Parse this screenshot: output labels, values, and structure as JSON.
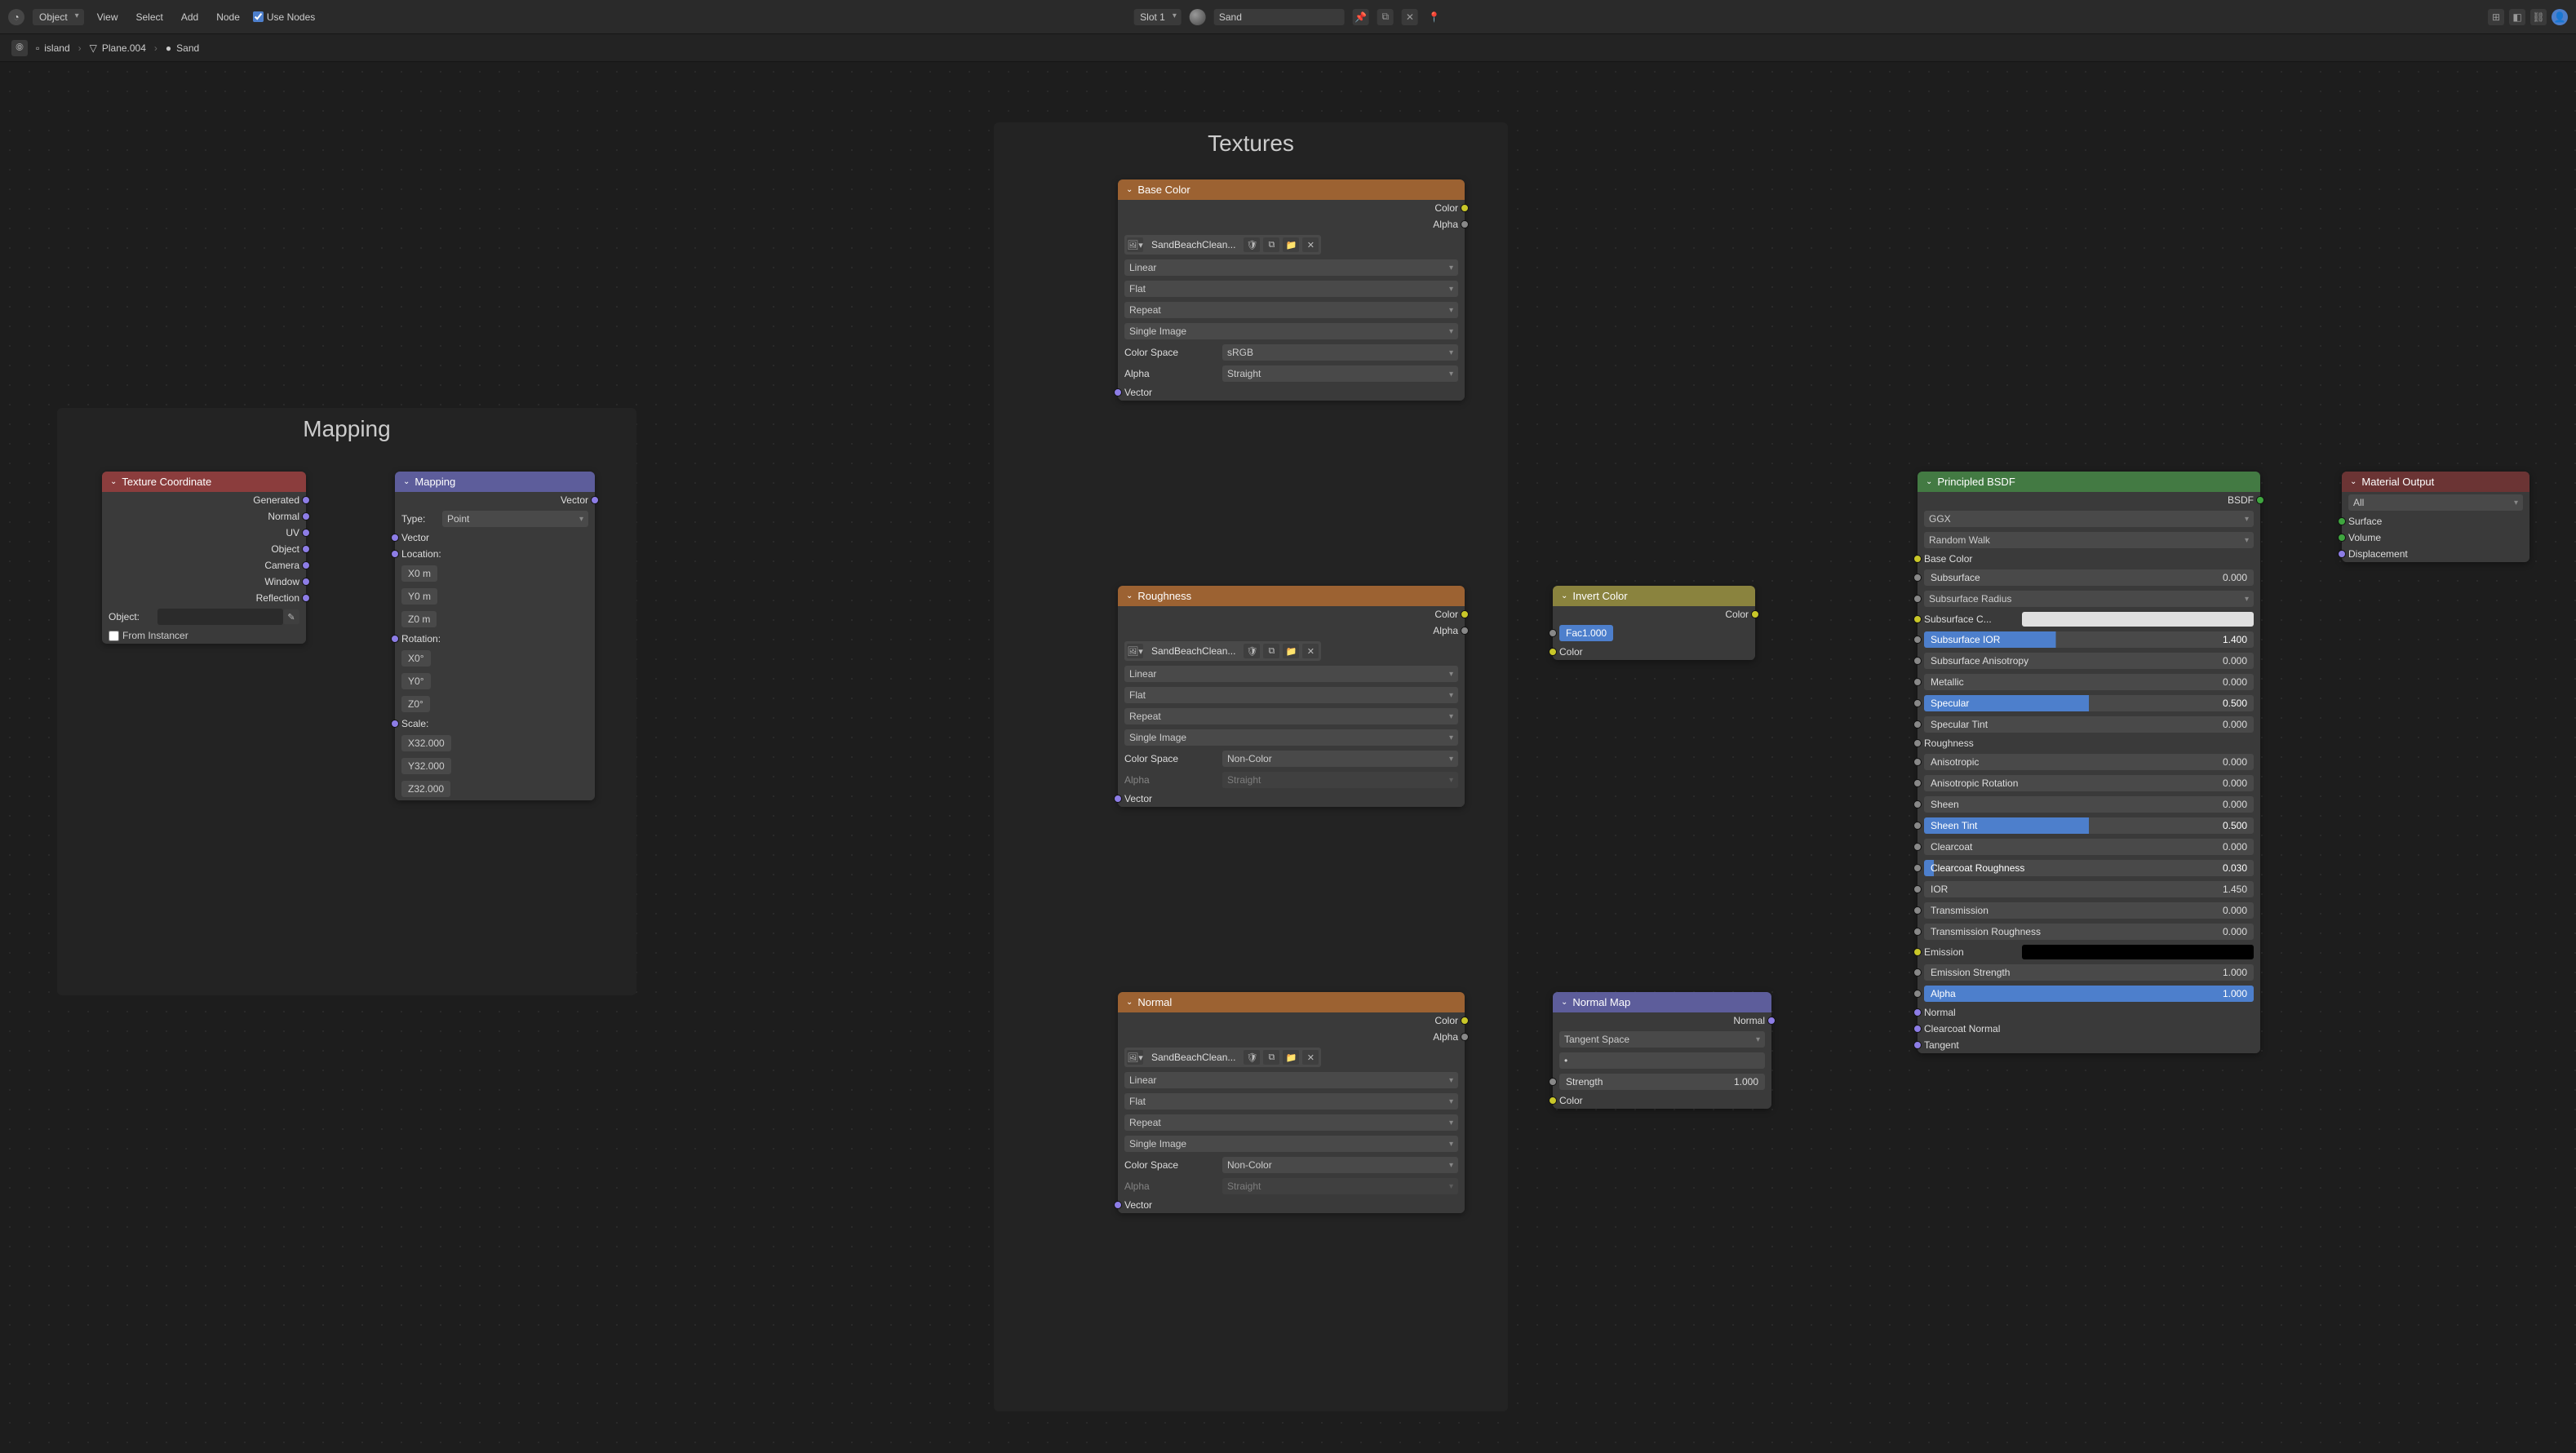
{
  "topbar": {
    "mode": "Object",
    "menus": [
      "View",
      "Select",
      "Add",
      "Node"
    ],
    "use_nodes": "Use Nodes",
    "slot": "Slot 1",
    "material": "Sand"
  },
  "breadcrumb": {
    "items": [
      "island",
      "Plane.004",
      "Sand"
    ]
  },
  "frames": {
    "mapping": "Mapping",
    "textures": "Textures"
  },
  "texcoord": {
    "title": "Texture Coordinate",
    "outs": [
      "Generated",
      "Normal",
      "UV",
      "Object",
      "Camera",
      "Window",
      "Reflection"
    ],
    "object_lbl": "Object:",
    "from_instancer": "From Instancer"
  },
  "mapping": {
    "title": "Mapping",
    "out": "Vector",
    "vector": "Vector",
    "type_lbl": "Type:",
    "type_val": "Point",
    "location": "Location:",
    "loc": {
      "x": "X",
      "xv": "0 m",
      "y": "Y",
      "yv": "0 m",
      "z": "Z",
      "zv": "0 m"
    },
    "rotation": "Rotation:",
    "rot": {
      "x": "X",
      "xv": "0°",
      "y": "Y",
      "yv": "0°",
      "z": "Z",
      "zv": "0°"
    },
    "scale": "Scale:",
    "scl": {
      "x": "X",
      "xv": "32.000",
      "y": "Y",
      "yv": "32.000",
      "z": "Z",
      "zv": "32.000"
    }
  },
  "img": {
    "color": "Color",
    "alpha": "Alpha",
    "vector": "Vector",
    "name": "SandBeachClean...",
    "interp": "Linear",
    "proj": "Flat",
    "ext": "Repeat",
    "source": "Single Image",
    "colorspace_lbl": "Color Space",
    "srgb": "sRGB",
    "noncolor": "Non-Color",
    "alpha_lbl": "Alpha",
    "straight": "Straight"
  },
  "tex_nodes": {
    "base": "Base Color",
    "rough": "Roughness",
    "normal": "Normal"
  },
  "invert": {
    "title": "Invert Color",
    "out": "Color",
    "fac": "Fac",
    "fac_v": "1.000",
    "color": "Color"
  },
  "nmap": {
    "title": "Normal Map",
    "out": "Normal",
    "space": "Tangent Space",
    "uvmap": "•",
    "strength": "Strength",
    "strength_v": "1.000",
    "color": "Color"
  },
  "bsdf": {
    "title": "Principled BSDF",
    "out": "BSDF",
    "distribution": "GGX",
    "sss": "Random Walk",
    "rows": [
      {
        "k": "base",
        "lbl": "Base Color",
        "sock": "yellow",
        "type": "text",
        "connected": true
      },
      {
        "k": "subsurface",
        "lbl": "Subsurface",
        "val": "0.000",
        "type": "prop"
      },
      {
        "k": "sss_radius",
        "lbl": "Subsurface Radius",
        "type": "drop"
      },
      {
        "k": "sss_color",
        "lbl": "Subsurface C...",
        "type": "color",
        "color": "#e0e0e0",
        "sock": "yellow"
      },
      {
        "k": "sss_ior",
        "lbl": "Subsurface IOR",
        "val": "1.400",
        "type": "lit",
        "pct": 40
      },
      {
        "k": "sss_aniso",
        "lbl": "Subsurface Anisotropy",
        "val": "0.000",
        "type": "prop"
      },
      {
        "k": "metallic",
        "lbl": "Metallic",
        "val": "0.000",
        "type": "prop"
      },
      {
        "k": "specular",
        "lbl": "Specular",
        "val": "0.500",
        "type": "lit",
        "pct": 50
      },
      {
        "k": "spectint",
        "lbl": "Specular Tint",
        "val": "0.000",
        "type": "prop"
      },
      {
        "k": "rough",
        "lbl": "Roughness",
        "type": "text",
        "connected": true
      },
      {
        "k": "aniso",
        "lbl": "Anisotropic",
        "val": "0.000",
        "type": "prop"
      },
      {
        "k": "aniso_rot",
        "lbl": "Anisotropic Rotation",
        "val": "0.000",
        "type": "prop"
      },
      {
        "k": "sheen",
        "lbl": "Sheen",
        "val": "0.000",
        "type": "prop"
      },
      {
        "k": "sheen_tint",
        "lbl": "Sheen Tint",
        "val": "0.500",
        "type": "lit",
        "pct": 50
      },
      {
        "k": "clearcoat",
        "lbl": "Clearcoat",
        "val": "0.000",
        "type": "prop"
      },
      {
        "k": "cc_rough",
        "lbl": "Clearcoat Roughness",
        "val": "0.030",
        "type": "lit",
        "pct": 3
      },
      {
        "k": "ior",
        "lbl": "IOR",
        "val": "1.450",
        "type": "prop"
      },
      {
        "k": "trans",
        "lbl": "Transmission",
        "val": "0.000",
        "type": "prop"
      },
      {
        "k": "trans_rough",
        "lbl": "Transmission Roughness",
        "val": "0.000",
        "type": "prop"
      },
      {
        "k": "emission",
        "lbl": "Emission",
        "type": "color",
        "color": "#000000",
        "sock": "yellow"
      },
      {
        "k": "emission_str",
        "lbl": "Emission Strength",
        "val": "1.000",
        "type": "prop"
      },
      {
        "k": "alpha",
        "lbl": "Alpha",
        "val": "1.000",
        "type": "lit",
        "pct": 100
      },
      {
        "k": "normal",
        "lbl": "Normal",
        "type": "text",
        "sock": "purple",
        "connected": true
      },
      {
        "k": "cc_normal",
        "lbl": "Clearcoat Normal",
        "type": "text",
        "sock": "purple"
      },
      {
        "k": "tangent",
        "lbl": "Tangent",
        "type": "text",
        "sock": "purple"
      }
    ]
  },
  "matout": {
    "title": "Material Output",
    "target": "All",
    "surface": "Surface",
    "volume": "Volume",
    "displacement": "Displacement"
  }
}
